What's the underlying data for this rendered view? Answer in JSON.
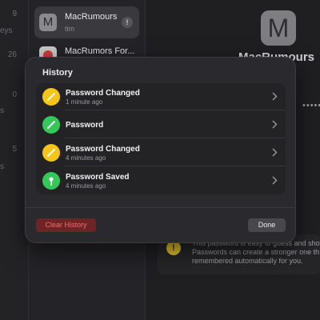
{
  "background": {
    "left_column": {
      "numbers": [
        "9",
        "26",
        "0",
        "5"
      ],
      "labels": [
        "eys",
        "s",
        "s"
      ]
    },
    "list": [
      {
        "tile_letter": "M",
        "title": "MacRumours",
        "subtitle": "tim",
        "badge": "!"
      },
      {
        "title": "MacRumors For..."
      }
    ],
    "detail": {
      "tile_letter": "M",
      "title": "MacRumours",
      "password_mask": "•••••",
      "warning_icon": "!",
      "warning_lines": [
        "This password is easy to guess and sho",
        "Passwords can create a stronger one th",
        "remembered automatically for you."
      ]
    }
  },
  "dialog": {
    "title": "History",
    "items": [
      {
        "title": "Password Changed",
        "subtitle": "1 minute ago",
        "icon": "pencil-icon",
        "color": "#f5c518"
      },
      {
        "title": "Password",
        "subtitle": "",
        "icon": "pencil-icon",
        "color": "#34c759"
      },
      {
        "title": "Password Changed",
        "subtitle": "4 minutes ago",
        "icon": "pencil-icon",
        "color": "#f5c518"
      },
      {
        "title": "Password Saved",
        "subtitle": "4 minutes ago",
        "icon": "key-icon",
        "color": "#34c759"
      }
    ],
    "clear_label": "Clear History",
    "done_label": "Done"
  },
  "colors": {
    "yellow": "#f5c518",
    "green": "#34c759",
    "danger_bg": "#6e2424",
    "danger_text": "#ef6e6e"
  }
}
